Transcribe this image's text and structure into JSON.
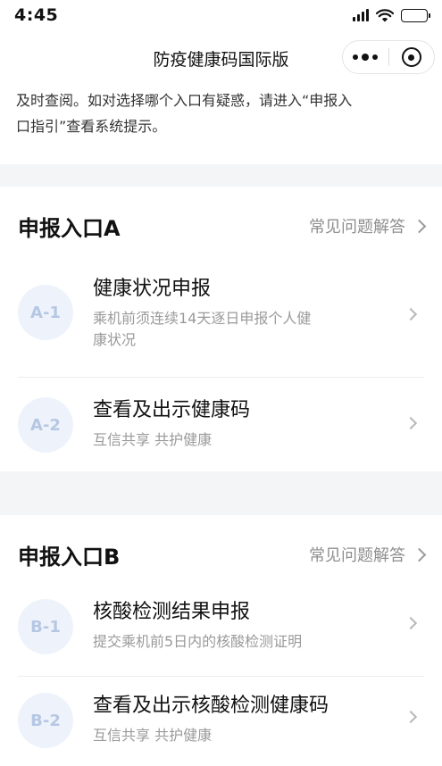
{
  "status_bar": {
    "time": "4:45"
  },
  "nav": {
    "title": "防疫健康码国际版"
  },
  "intro": {
    "line1": "及时查阅。如对选择哪个入口有疑惑，请进入“申报入",
    "line2": "口指引”查看系统提示。"
  },
  "section_a": {
    "title": "申报入口A",
    "faq_label": "常见问题解答",
    "entries": [
      {
        "badge": "A-1",
        "title": "健康状况申报",
        "sub_line1": "乘机前须连续14天逐日申报个人健",
        "sub_line2": "康状况"
      },
      {
        "badge": "A-2",
        "title": "查看及出示健康码",
        "sub_line1": "互信共享 共护健康"
      }
    ]
  },
  "section_b": {
    "title": "申报入口B",
    "faq_label": "常见问题解答",
    "entries": [
      {
        "badge": "B-1",
        "title": "核酸检测结果申报",
        "sub_line1": "提交乘机前5日内的核酸检测证明"
      },
      {
        "badge": "B-2",
        "title": "查看及出示核酸检测健康码",
        "sub_line1": "互信共享 共护健康"
      }
    ]
  },
  "colors": {
    "badge_bg": "#eef3fb",
    "badge_text": "#b6c7e4",
    "page_bg": "#f4f5f7"
  }
}
